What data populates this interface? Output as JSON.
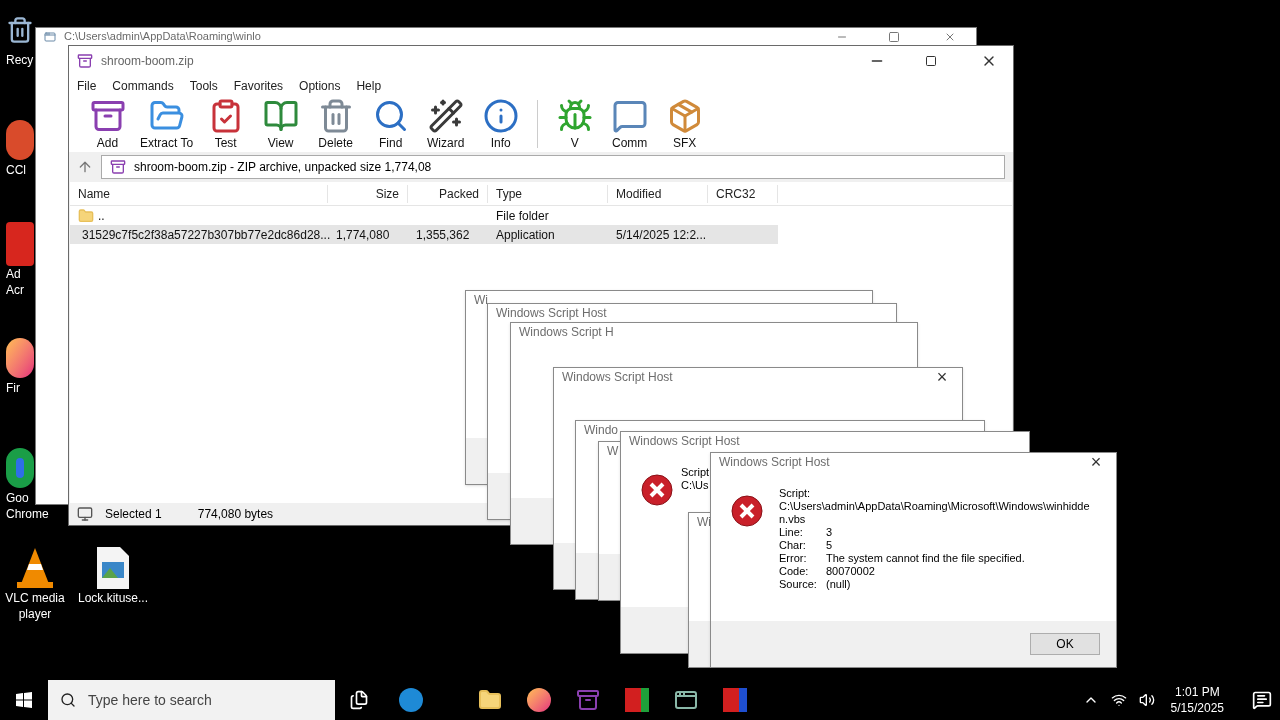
{
  "desktop_icons": [
    {
      "kind": "recycle",
      "lines": [
        "Recy"
      ]
    },
    {
      "kind": "app",
      "lines": [
        "CCl"
      ]
    },
    {
      "kind": "pdf",
      "lines": [
        "Ad",
        "Acr"
      ]
    },
    {
      "kind": "firefox",
      "lines": [
        "Fir"
      ]
    },
    {
      "kind": "chrome",
      "lines": [
        "Goo",
        "Chrome"
      ]
    },
    {
      "kind": "vlc",
      "lines": [
        "VLC media",
        "player"
      ]
    },
    {
      "kind": "image",
      "lines": [
        "Lock.kituse..."
      ]
    }
  ],
  "back_window": {
    "title": "C:\\Users\\admin\\AppData\\Roaming\\winlo"
  },
  "winrar": {
    "title": "shroom-boom.zip",
    "menu": [
      "File",
      "Commands",
      "Tools",
      "Favorites",
      "Options",
      "Help"
    ],
    "toolbar": [
      {
        "kind": "add",
        "label": "Add"
      },
      {
        "kind": "extract",
        "label": "Extract To"
      },
      {
        "kind": "test",
        "label": "Test"
      },
      {
        "kind": "view",
        "label": "View"
      },
      {
        "kind": "delete",
        "label": "Delete"
      },
      {
        "kind": "find",
        "label": "Find"
      },
      {
        "kind": "wizard",
        "label": "Wizard"
      },
      {
        "kind": "info",
        "label": "Info"
      },
      {
        "kind": "virus",
        "label": "V"
      },
      {
        "kind": "comment",
        "label": "Comm"
      },
      {
        "kind": "sfx",
        "label": "SFX"
      }
    ],
    "address": "shroom-boom.zip - ZIP archive, unpacked size 1,774,08",
    "columns": [
      "Name",
      "Size",
      "Packed",
      "Type",
      "Modified",
      "CRC32"
    ],
    "rows": [
      {
        "kind": "folder",
        "selected": false,
        "cells": [
          "..",
          "",
          "",
          "File folder",
          "",
          ""
        ]
      },
      {
        "kind": "file",
        "selected": true,
        "cells": [
          "31529c7f5c2f38a57227b307bb77e2dc86d28...",
          "1,774,080",
          "1,355,362",
          "Application",
          "5/14/2025 12:2...",
          ""
        ]
      }
    ],
    "status": [
      "Selected 1",
      "774,080 bytes"
    ]
  },
  "dialogs": [
    {
      "title": "Wi"
    },
    {
      "title": "Windows Script Host"
    },
    {
      "title": "Windows Script H"
    },
    {
      "title": "Windows Script Host",
      "close": "×"
    },
    {
      "title": "Windo"
    },
    {
      "title": "W"
    },
    {
      "title": "Windows Script Host",
      "lines": [
        "Script",
        "C:\\Us"
      ]
    },
    {
      "title": "Wi"
    },
    {
      "title": "Windows Script Host",
      "close": "×",
      "script_label": "Script:",
      "script_path": "C:\\Users\\admin\\AppData\\Roaming\\Microsoft\\Windows\\winhidden.vbs",
      "fields": [
        [
          "Line:",
          "3"
        ],
        [
          "Char:",
          "5"
        ],
        [
          "Error:",
          "The system cannot find the file specified."
        ],
        [
          "Code:",
          "80070002"
        ],
        [
          "Source:",
          "(null)"
        ]
      ],
      "button": "OK"
    }
  ],
  "taskbar": {
    "search_placeholder": "Type here to search",
    "time": "1:01 PM",
    "date": "5/15/2025"
  }
}
